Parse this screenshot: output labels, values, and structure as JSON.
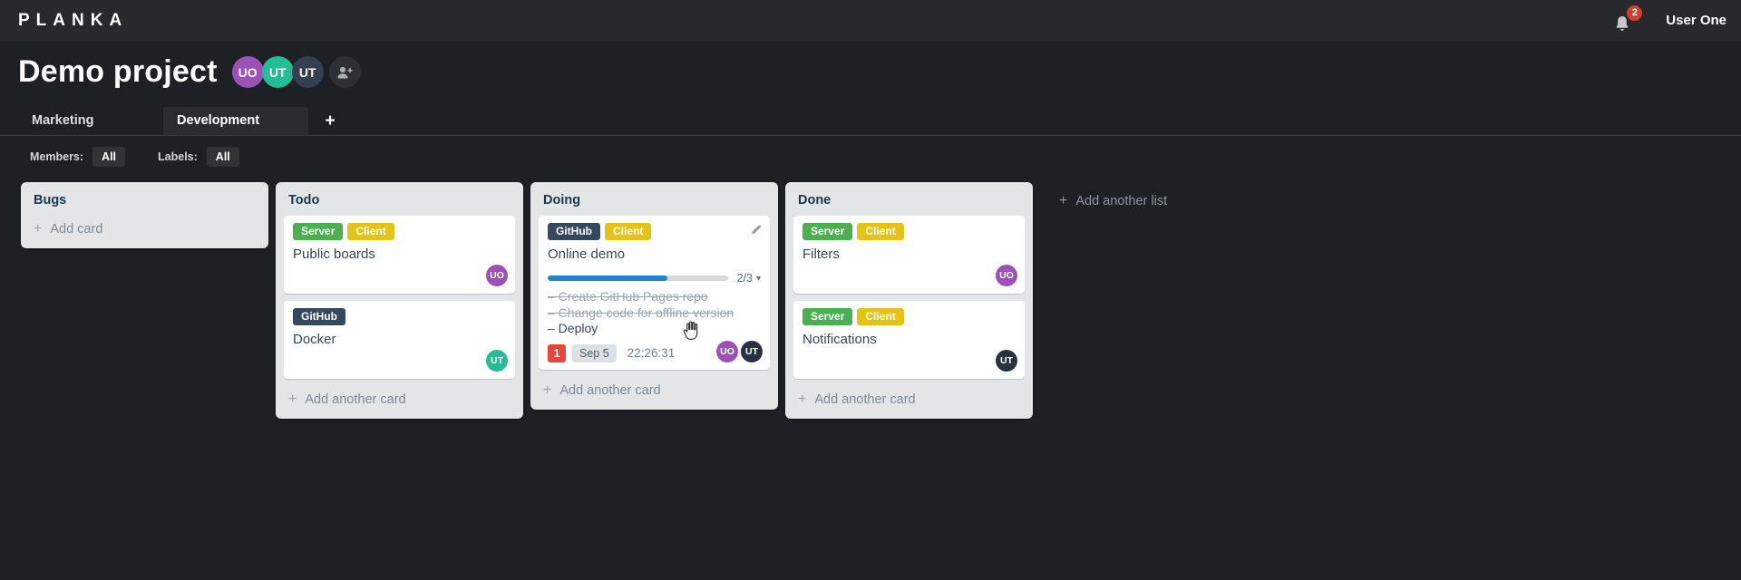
{
  "topbar": {
    "logo": "PLANKA",
    "notification_count": "2",
    "user_name": "User One"
  },
  "project": {
    "title": "Demo project",
    "members": [
      {
        "initials": "UO",
        "color": "#9b51b5"
      },
      {
        "initials": "UT",
        "color": "#24bd95"
      },
      {
        "initials": "UT",
        "color": "#334050"
      }
    ]
  },
  "tabs": [
    {
      "label": "Marketing",
      "active": false
    },
    {
      "label": "Development",
      "active": true
    }
  ],
  "add_tab_label": "+",
  "filters": {
    "members_label": "Members:",
    "members_value": "All",
    "labels_label": "Labels:",
    "labels_value": "All"
  },
  "icons": {
    "plus": "+",
    "caret_down": "▾",
    "task_dash": "–"
  },
  "colors": {
    "progress_bar": "#2185d0",
    "notification_badge": "#e2483c"
  },
  "board": {
    "add_list_label": "Add another list",
    "lists": [
      {
        "title": "Bugs",
        "footer": "Add card",
        "cards": []
      },
      {
        "title": "Todo",
        "footer": "Add another card",
        "cards": [
          {
            "title": "Public boards",
            "labels": [
              {
                "text": "Server",
                "color": "#4caf50"
              },
              {
                "text": "Client",
                "color": "#e4c315"
              }
            ],
            "members": [
              {
                "initials": "UO",
                "color": "#9b51b5"
              }
            ]
          },
          {
            "title": "Docker",
            "labels": [
              {
                "text": "GitHub",
                "color": "#34495e"
              }
            ],
            "members": [
              {
                "initials": "UT",
                "color": "#24bd95"
              }
            ]
          }
        ]
      },
      {
        "title": "Doing",
        "footer": "Add another card",
        "cards": [
          {
            "title": "Online demo",
            "labels": [
              {
                "text": "GitHub",
                "color": "#34495e"
              },
              {
                "text": "Client",
                "color": "#e4c315"
              }
            ],
            "editable": true,
            "progress": {
              "done": 2,
              "total": 3,
              "label": "2/3"
            },
            "tasks": [
              {
                "text": "Create GitHub Pages repo",
                "done": true
              },
              {
                "text": "Change code for offline version",
                "done": true
              },
              {
                "text": "Deploy",
                "done": false
              }
            ],
            "badges": {
              "notification_count": "1",
              "due_date": "Sep 5",
              "timer": "22:26:31"
            },
            "members": [
              {
                "initials": "UO",
                "color": "#9b51b5"
              },
              {
                "initials": "UT",
                "color": "#293340"
              }
            ]
          }
        ]
      },
      {
        "title": "Done",
        "footer": "Add another card",
        "cards": [
          {
            "title": "Filters",
            "labels": [
              {
                "text": "Server",
                "color": "#4caf50"
              },
              {
                "text": "Client",
                "color": "#e4c315"
              }
            ],
            "members": [
              {
                "initials": "UO",
                "color": "#9b51b5"
              }
            ]
          },
          {
            "title": "Notifications",
            "labels": [
              {
                "text": "Server",
                "color": "#4caf50"
              },
              {
                "text": "Client",
                "color": "#e4c315"
              }
            ],
            "members": [
              {
                "initials": "UT",
                "color": "#293340"
              }
            ]
          }
        ]
      }
    ]
  }
}
